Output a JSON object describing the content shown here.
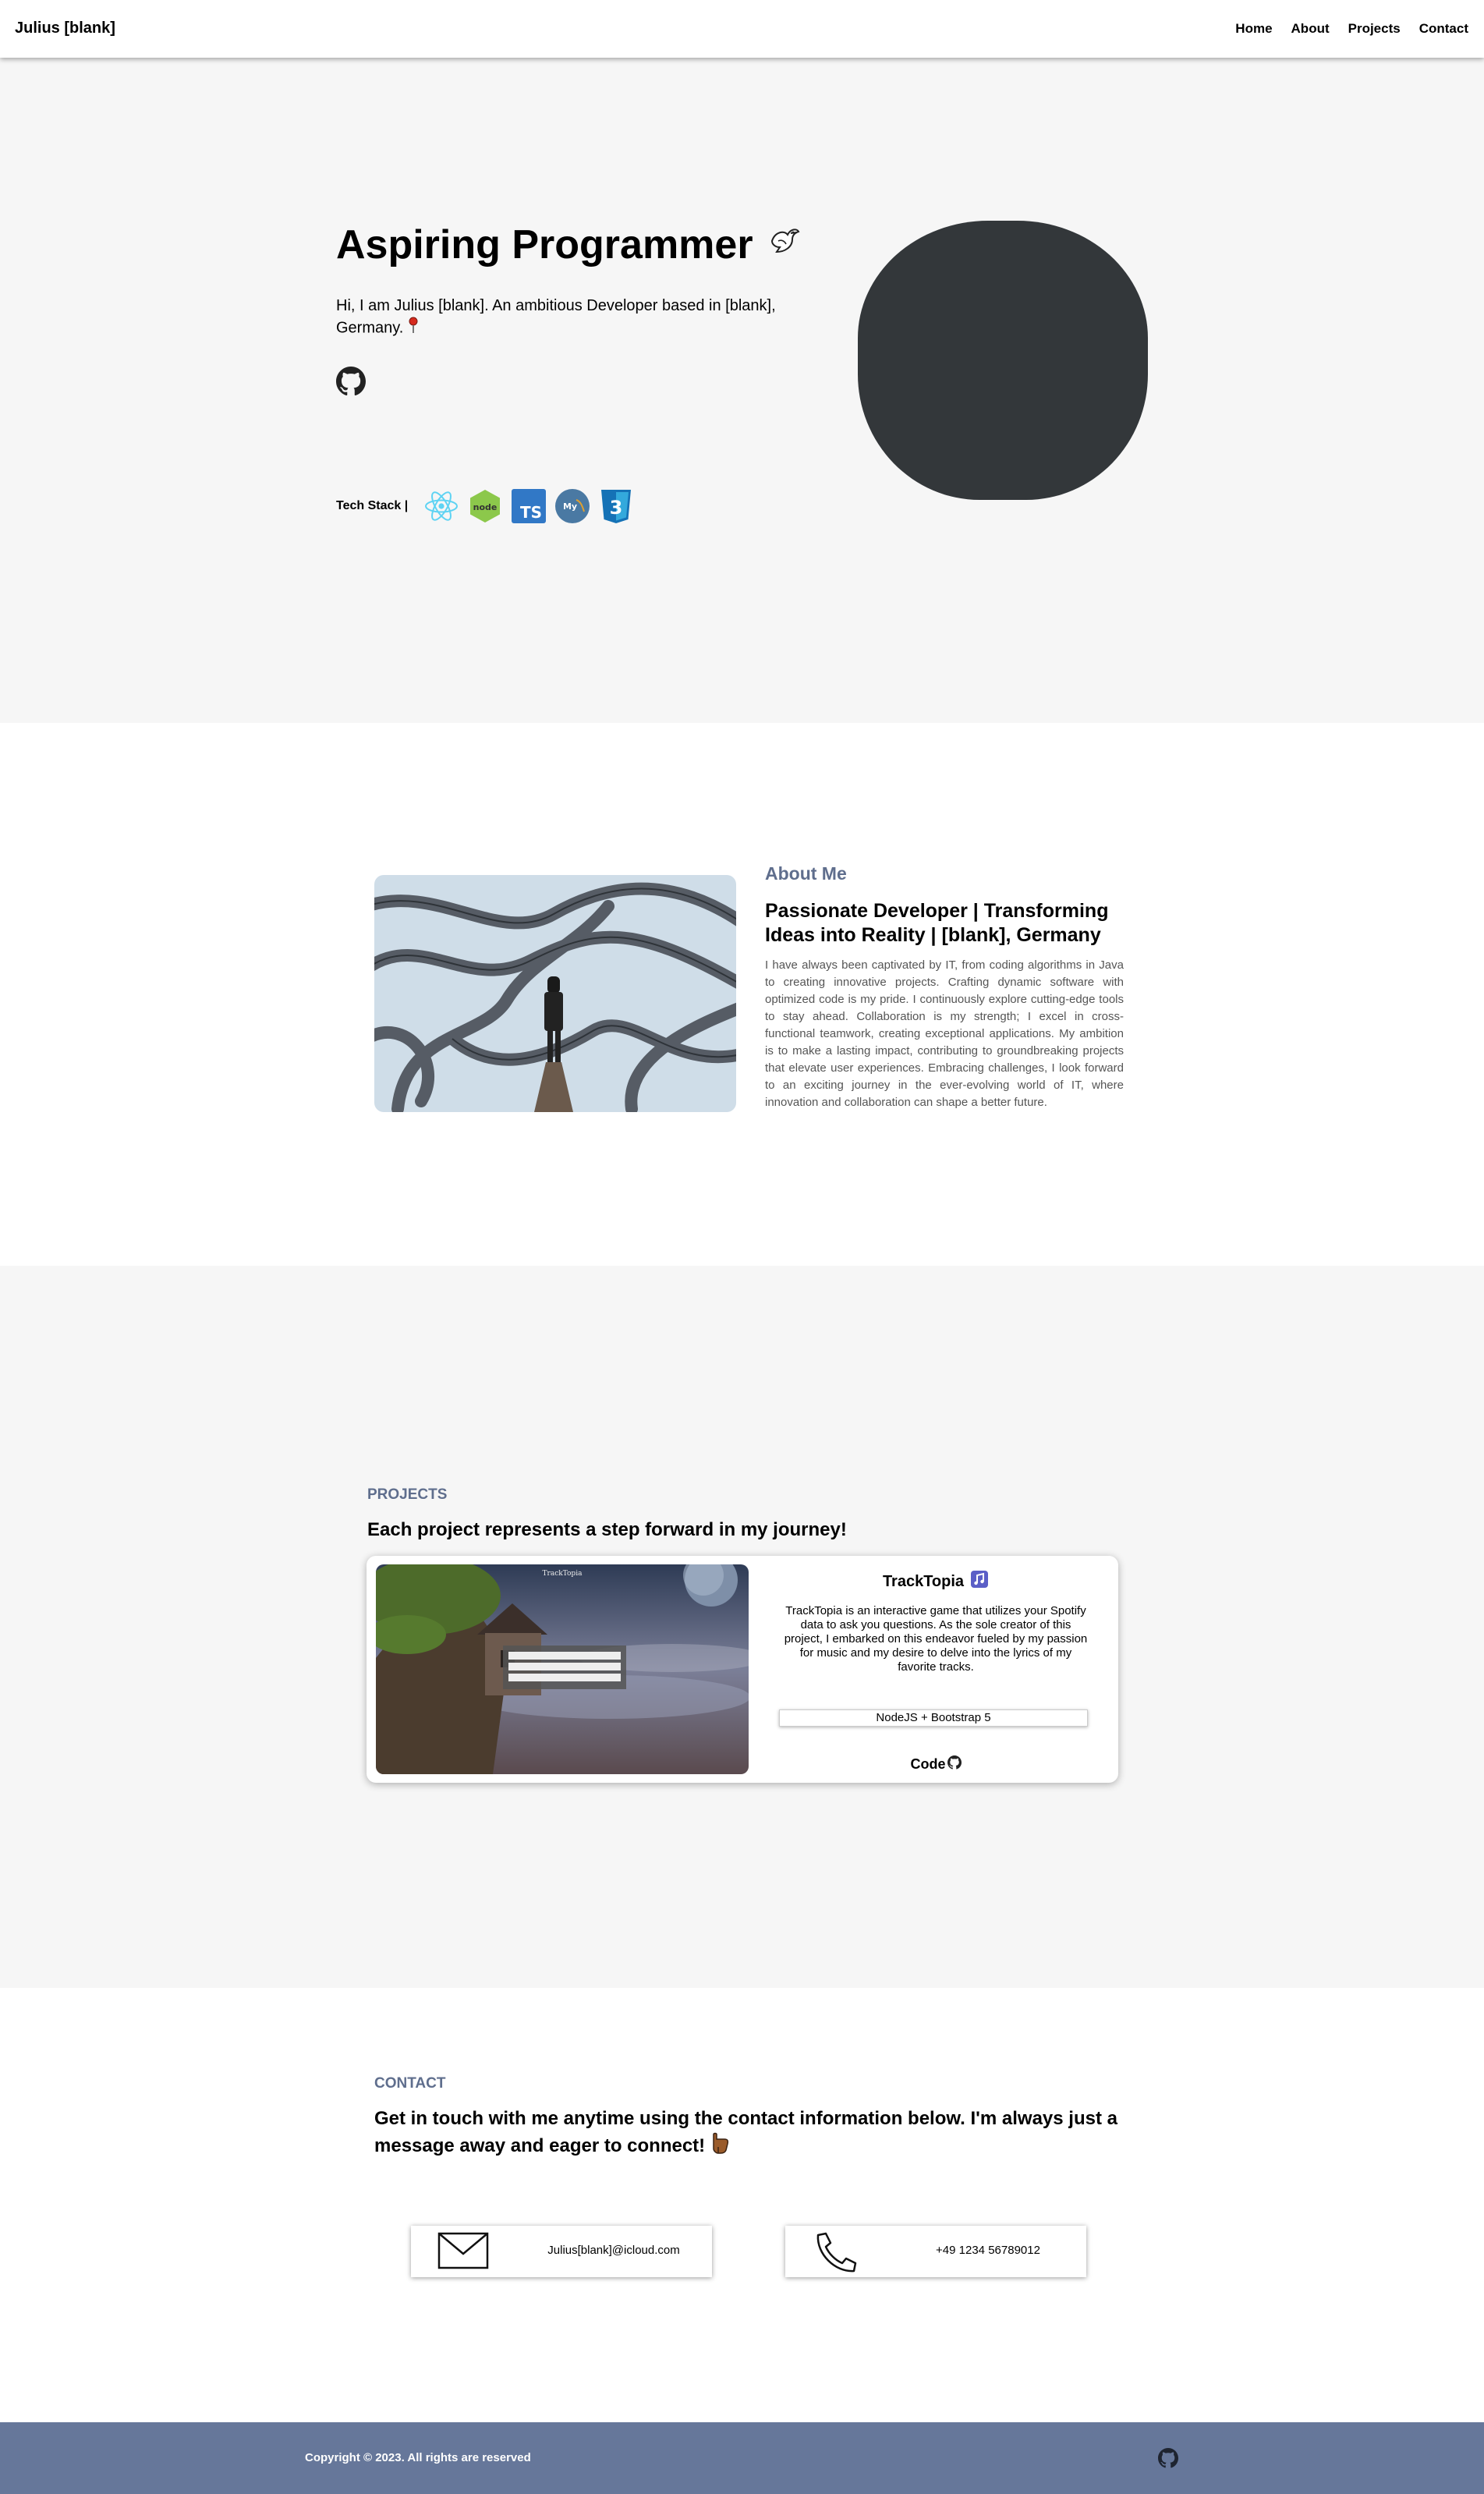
{
  "nav": {
    "brand": "Julius [blank]",
    "links": [
      "Home",
      "About",
      "Projects",
      "Contact"
    ]
  },
  "hero": {
    "title": "Aspiring Programmer",
    "title_emoji": "dove-icon",
    "intro": "Hi, I am Julius [blank]. An ambitious Developer based in [blank], Germany.",
    "techstack_label": "Tech Stack |",
    "techstack_icons": [
      "react-icon",
      "nodejs-icon",
      "typescript-icon",
      "mysql-icon",
      "css3-icon"
    ]
  },
  "about": {
    "label": "About Me",
    "heading": "Passionate Developer | Transforming Ideas into Reality | [blank], Germany",
    "body": "I have always been captivated by IT, from coding algorithms in Java to creating innovative projects. Crafting dynamic software with optimized code is my pride. I continuously explore cutting-edge tools to stay ahead. Collaboration is my strength; I excel in cross-functional teamwork, creating exceptional applications. My ambition is to make a lasting impact, contributing to groundbreaking projects that elevate user experiences. Embracing challenges, I look forward to an exciting journey in the ever-evolving world of IT, where innovation and collaboration can shape a better future."
  },
  "projects": {
    "label": "PROJECTS",
    "heading": "Each project represents a step forward in my journey!",
    "items": [
      {
        "title": "TrackTopia",
        "thumb_caption": "TrackTopia",
        "description": "TrackTopia is an interactive game that utilizes your Spotify data to ask you questions. As the sole creator of this project, I embarked on this endeavor fueled by my passion for music and my desire to delve into the lyrics of my favorite tracks.",
        "stack": "NodeJS + Bootstrap 5",
        "code_label": "Code"
      }
    ]
  },
  "contact": {
    "label": "CONTACT",
    "heading": "Get in touch with me anytime using the contact information below. I'm always just a message away and eager to connect!",
    "email": "Julius[blank]@icloud.com",
    "phone": "+49 1234 56789012"
  },
  "footer": {
    "copyright": "Copyright © 2023. All rights are reserved"
  },
  "colors": {
    "accent": "#5f6e8d",
    "footer_bg": "#66779a",
    "hero_bg": "#f6f6f6",
    "blob": "#33373a"
  }
}
